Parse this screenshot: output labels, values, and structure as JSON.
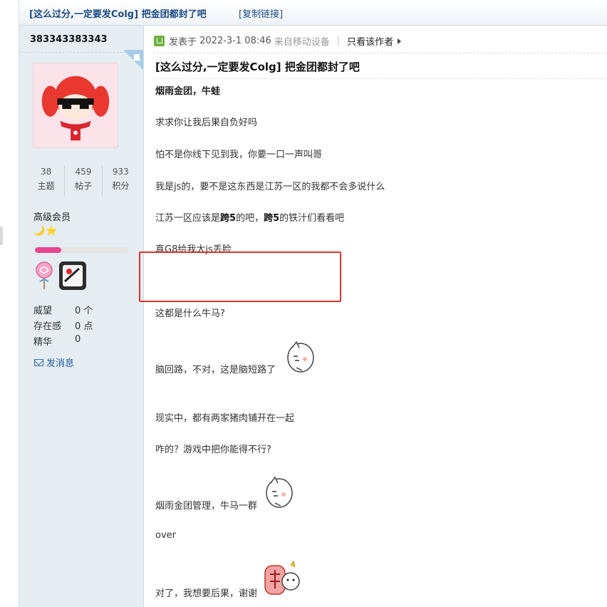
{
  "thread": {
    "title": "[这么过分,一定要发Colg] 把金团都封了吧",
    "copy_link": "[复制链接]"
  },
  "author": {
    "username": "383343383343",
    "stats": [
      {
        "value": "38",
        "label": "主题"
      },
      {
        "value": "459",
        "label": "帖子"
      },
      {
        "value": "933",
        "label": "积分"
      }
    ],
    "rank": "高级会员",
    "rank_icons": "🌙⭐",
    "level_progress": 0.28,
    "info": [
      {
        "key": "威望",
        "value": "0 个"
      },
      {
        "key": "存在感",
        "value": "0 点"
      },
      {
        "key": "精华",
        "value": "0"
      }
    ],
    "send_message": "发消息"
  },
  "post": {
    "posted_prefix": "发表于",
    "posted_at": "2022-3-1 08:46",
    "device": "来自移动设备",
    "only_author": "只看该作者",
    "title": "[这么过分,一定要发Colg] 把金团都封了吧",
    "lines": {
      "l1": "烟雨金团，牛蛙",
      "l2": "求求你让我后果自负好吗",
      "l3": "怕不是你线下见到我，你要一口一声叫哥",
      "l4": "我是js的，要不是这东西是江苏一区的我都不会多说什么",
      "l5_a": "江苏一区应该是",
      "l5_b": "跨5",
      "l5_c": "的吧，",
      "l5_d": "跨5",
      "l5_e": "的铁汁们看看吧",
      "l6": "真G8给我大js丢脸",
      "l7": "这都是什么牛马?",
      "l8": "脑回路，不对，这是脑短路了",
      "l9": "现实中，都有两家猪肉铺开在一起",
      "l10": "咋的？游戏中把你能得不行?",
      "l11": "烟雨金团管理，牛马一群",
      "l12": "over",
      "l13": "对了，我想要后果，谢谢"
    }
  },
  "colors": {
    "accent_blue": "#1c4a84",
    "sidebar_bg": "#e5edf2",
    "highlight_red": "#e0322d",
    "progress_pink": "#e8478f"
  }
}
